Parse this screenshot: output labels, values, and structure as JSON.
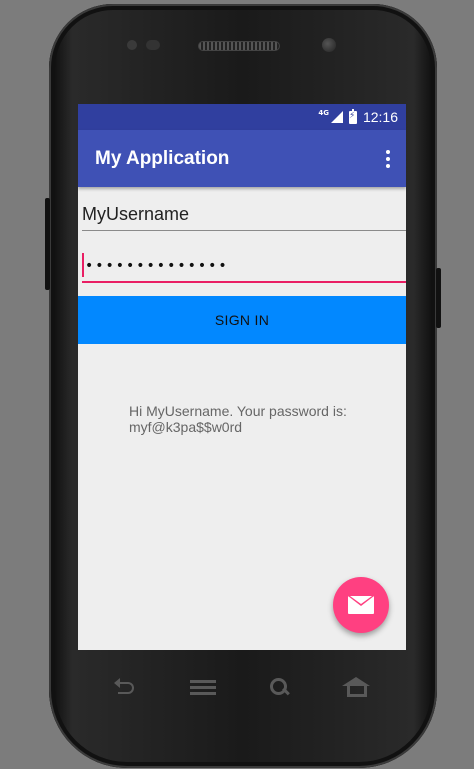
{
  "status_bar": {
    "network_type": "4G",
    "time": "12:16"
  },
  "app_bar": {
    "title": "My Application"
  },
  "form": {
    "username_value": "MyUsername",
    "password_masked": "••••••••••••••",
    "sign_in_label": "SIGN IN"
  },
  "result": {
    "message": "Hi MyUsername. Your password is: myf@k3pa$$w0rd"
  },
  "colors": {
    "status_bar": "#303f9f",
    "app_bar": "#3f51b5",
    "button": "#0288ff",
    "fab": "#ff4081",
    "accent": "#e91e63"
  },
  "icons": {
    "overflow": "more-vert-icon",
    "fab": "email-icon",
    "nav": [
      "back-icon",
      "menu-icon",
      "search-icon",
      "home-icon"
    ]
  }
}
